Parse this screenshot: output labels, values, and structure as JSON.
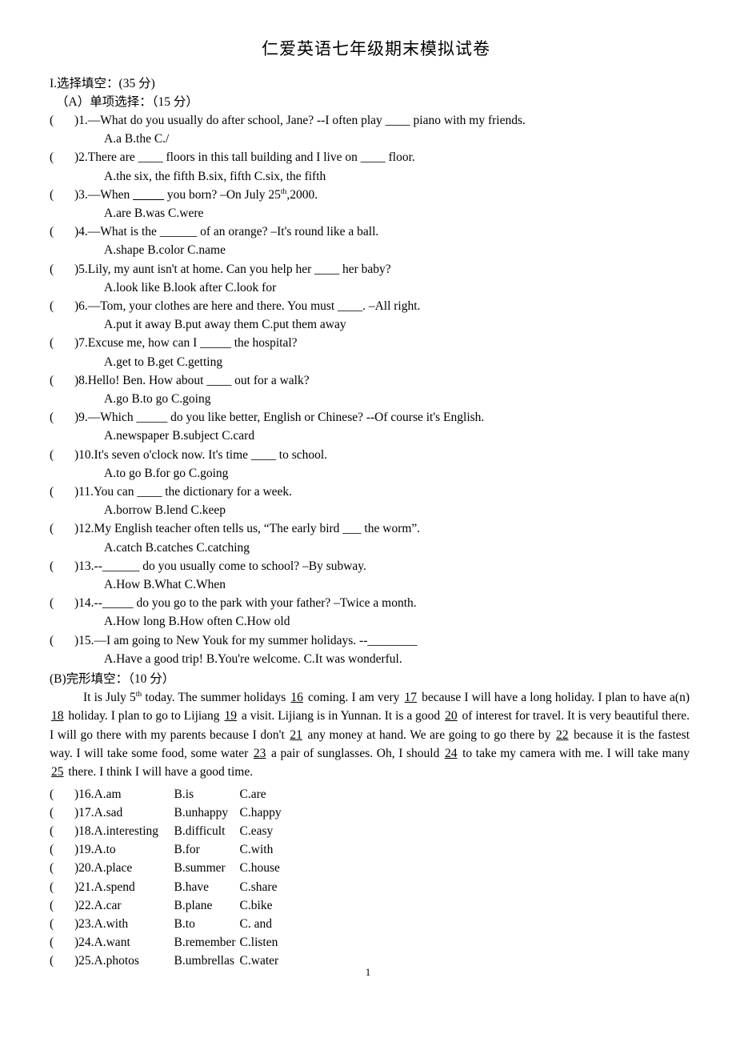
{
  "document": {
    "title": "仁爱英语七年级期末模拟试卷",
    "page_number": "1"
  },
  "section_one": {
    "heading": "I.选择填空：(35 分)",
    "part_a_heading": "（A）单项选择：（15 分）"
  },
  "single_choice": [
    {
      "marker": "(",
      "close": ")",
      "stem": "1.—What do you usually do after school, Jane?   --I often play ____  piano with my friends.",
      "options": "A.a            B.the            C./"
    },
    {
      "marker": "(",
      "close": ")",
      "stem": "2.There are ____  floors in this tall building and I live on ____  floor.",
      "options": "A.the six, the fifth     B.six, fifth     C.six, the fifth"
    },
    {
      "marker": "(",
      "close": ")",
      "stem": "3.—When _____ you born? –On July 25th,2000.",
      "stem_pre": "3.—When ",
      "stem_blank": "_____",
      "stem_mid": " you born? –On July 25",
      "stem_sup": "th",
      "stem_post": ",2000.",
      "options": "A.are      B.was     C.were"
    },
    {
      "marker": "(",
      "close": ")",
      "stem": "4.—What is the ______  of an orange? –It's round like a ball.",
      "options": "A.shape      B.color     C.name"
    },
    {
      "marker": "(",
      "close": ")",
      "stem": "5.Lily, my aunt isn't at home. Can you help her ____  her baby?",
      "options": "A.look like      B.look after    C.look for"
    },
    {
      "marker": "(",
      "close": ")",
      "stem": "6.—Tom, your clothes are here and there. You must ____. –All right.",
      "options": "A.put it away     B.put away them   C.put them away"
    },
    {
      "marker": "(",
      "close": ")",
      "stem": "7.Excuse me, how can I _____  the hospital?",
      "options": "A.get to     B.get    C.getting"
    },
    {
      "marker": "(",
      "close": ")",
      "stem": "8.Hello! Ben. How about ____  out for a walk?",
      "options": "A.go     B.to go    C.going"
    },
    {
      "marker": "(",
      "close": ")",
      "stem": "9.—Which _____  do you like better, English or Chinese?   --Of course it's English.",
      "options": "A.newspaper     B.subject    C.card"
    },
    {
      "marker": "(",
      "close": ")",
      "stem": "10.It's seven o'clock now. It's time ____  to school.",
      "options": "A.to go     B.for go    C.going"
    },
    {
      "marker": "(",
      "close": ")",
      "stem": "11.You can ____  the dictionary for a week.",
      "options": "A.borrow     B.lend     C.keep"
    },
    {
      "marker": "(",
      "close": ")",
      "stem": "12.My English teacher often tells us, “The early bird ___  the worm”.",
      "options": "A.catch      B.catches    C.catching"
    },
    {
      "marker": "(",
      "close": ")",
      "stem": "13.--______  do you usually come to school? –By subway.",
      "options": "A.How     B.What    C.When"
    },
    {
      "marker": "(",
      "close": ")",
      "stem": "14.--_____  do you go to the park with your father? –Twice a month.",
      "options": "A.How long     B.How often    C.How old"
    },
    {
      "marker": "(",
      "close": ")",
      "stem": "15.—I am going to New Youk for my summer holidays. --________",
      "options": "A.Have a good trip!   B.You're welcome.    C.It was wonderful."
    }
  ],
  "part_b": {
    "heading": "(B)完形填空：（10 分）",
    "passage_segments": [
      {
        "type": "text",
        "value": "It is July 5"
      },
      {
        "type": "sup",
        "value": "th"
      },
      {
        "type": "text",
        "value": " today. The summer holidays "
      },
      {
        "type": "blank",
        "value": "16"
      },
      {
        "type": "text",
        "value": " coming. I am very "
      },
      {
        "type": "blank",
        "value": "17"
      },
      {
        "type": "text",
        "value": " because I will have a long holiday. I plan to have a(n) "
      },
      {
        "type": "blank",
        "value": "18"
      },
      {
        "type": "text",
        "value": " holiday. I plan to go to Lijiang "
      },
      {
        "type": "blank",
        "value": "19"
      },
      {
        "type": "text",
        "value": " a visit. Lijiang is in Yunnan. It is a good "
      },
      {
        "type": "blank",
        "value": "20"
      },
      {
        "type": "text",
        "value": " of interest for travel. It is very beautiful there. I will go there with my parents because I don't "
      },
      {
        "type": "blank",
        "value": "21"
      },
      {
        "type": "text",
        "value": " any money at hand. We are going to go there by "
      },
      {
        "type": "blank",
        "value": "22"
      },
      {
        "type": "text",
        "value": " because it is the fastest way. I will take some food, some water "
      },
      {
        "type": "blank",
        "value": "23"
      },
      {
        "type": "text",
        "value": " a pair of sunglasses. Oh, I should "
      },
      {
        "type": "blank",
        "value": "24"
      },
      {
        "type": "text",
        "value": " to take my camera with me. I will take many "
      },
      {
        "type": "blank",
        "value": "25"
      },
      {
        "type": "text",
        "value": " there. I think I will have a good time."
      }
    ]
  },
  "cloze_choices": [
    {
      "marker": "(",
      "close": ")",
      "num": "16.",
      "a": "A.am",
      "b": "B.is",
      "c": "C.are"
    },
    {
      "marker": "(",
      "close": ")",
      "num": "17.",
      "a": "A.sad",
      "b": "B.unhappy",
      "c": "C.happy"
    },
    {
      "marker": "(",
      "close": ")",
      "num": "18.",
      "a": "A.interesting",
      "b": "B.difficult",
      "c": "C.easy"
    },
    {
      "marker": "(",
      "close": ")",
      "num": "19.",
      "a": "A.to",
      "b": "B.for",
      "c": "C.with"
    },
    {
      "marker": "(",
      "close": ")",
      "num": "20.",
      "a": "A.place",
      "b": "B.summer",
      "c": "C.house"
    },
    {
      "marker": "(",
      "close": ")",
      "num": "21.",
      "a": "A.spend",
      "b": "B.have",
      "c": "C.share"
    },
    {
      "marker": "(",
      "close": ")",
      "num": "22.",
      "a": "A.car",
      "b": "B.plane",
      "c": "C.bike"
    },
    {
      "marker": "(",
      "close": ")",
      "num": "23.",
      "a": "A.with",
      "b": "B.to",
      "c": "C. and"
    },
    {
      "marker": "(",
      "close": ")",
      "num": "24.",
      "a": "A.want",
      "b": "B.remember",
      "c": "C.listen"
    },
    {
      "marker": "(",
      "close": ")",
      "num": "25.",
      "a": "A.photos",
      "b": "B.umbrellas",
      "c": "C.water"
    }
  ]
}
